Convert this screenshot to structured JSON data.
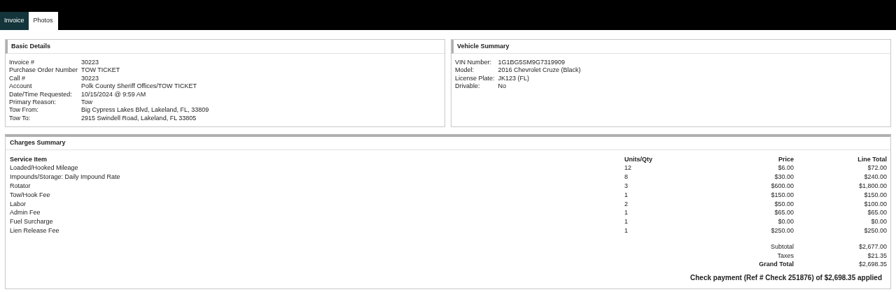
{
  "tabs": [
    {
      "label": "Invoice",
      "selected": true
    },
    {
      "label": "Photos",
      "selected": false
    }
  ],
  "basic_details": {
    "title": "Basic Details",
    "fields": [
      {
        "label": "Invoice #",
        "value": "30223"
      },
      {
        "label": "Purchase Order Number",
        "value": "TOW TICKET"
      },
      {
        "label": "Call #",
        "value": "30223"
      },
      {
        "label": "Account",
        "value": "Polk County Sheriff Offices/TOW TICKET"
      },
      {
        "label": "Date/Time Requested:",
        "value": "10/15/2024 @ 9:59 AM"
      },
      {
        "label": "Primary Reason:",
        "value": "Tow"
      },
      {
        "label": "Tow From:",
        "value": "Big Cypress Lakes Blvd, Lakeland, FL, 33809"
      },
      {
        "label": "Tow To:",
        "value": "2915 Swindell Road, Lakeland, FL 33805"
      }
    ]
  },
  "vehicle_summary": {
    "title": "Vehicle Summary",
    "fields": [
      {
        "label": "VIN Number:",
        "value": "1G1BG5SM9G7319909"
      },
      {
        "label": "Model:",
        "value": "2016 Chevrolet Cruze (Black)"
      },
      {
        "label": "License Plate:",
        "value": "JK123 (FL)"
      },
      {
        "label": "Drivable:",
        "value": "No"
      }
    ]
  },
  "charges_summary": {
    "title": "Charges Summary",
    "columns": [
      "Service Item",
      "Units/Qty",
      "Price",
      "Line Total"
    ],
    "rows": [
      [
        "Loaded/Hooked Mileage",
        "12",
        "$6.00",
        "$72.00"
      ],
      [
        "Impounds/Storage: Daily Impound Rate",
        "8",
        "$30.00",
        "$240.00"
      ],
      [
        "Rotator",
        "3",
        "$600.00",
        "$1,800.00"
      ],
      [
        "Tow/Hook Fee",
        "1",
        "$150.00",
        "$150.00"
      ],
      [
        "Labor",
        "2",
        "$50.00",
        "$100.00"
      ],
      [
        "Admin Fee",
        "1",
        "$65.00",
        "$65.00"
      ],
      [
        "Fuel Surcharge",
        "1",
        "$0.00",
        "$0.00"
      ],
      [
        "Lien Release Fee",
        "1",
        "$250.00",
        "$250.00"
      ]
    ],
    "totals": [
      {
        "label": "Subtotal",
        "value": "$2,677.00",
        "kind": "normal"
      },
      {
        "label": "Taxes",
        "value": "$21.35",
        "kind": "normal"
      },
      {
        "label": "Grand Total",
        "value": "$2,698.35",
        "kind": "grand"
      }
    ],
    "payment_note": "Check payment (Ref # Check 251876) of $2,698.35 applied"
  }
}
